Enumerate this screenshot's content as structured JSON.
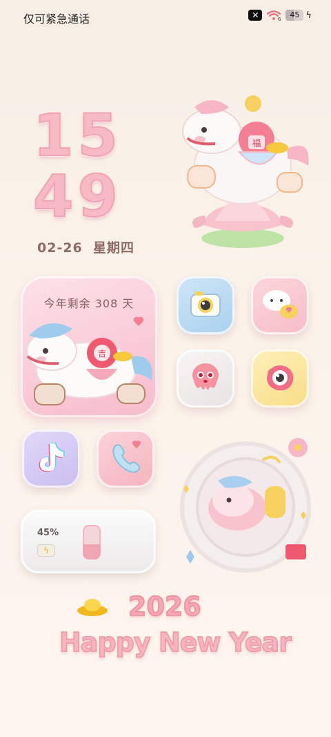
{
  "status_bar": {
    "carrier_text": "仅可紧急通话",
    "sim_icon": "sim-disabled-icon",
    "wifi_icon": "wifi-icon",
    "wifi_label": "6",
    "battery_level": "45",
    "charging_icon": "lightning-icon"
  },
  "clock": {
    "hours": "15",
    "minutes": "49",
    "date": "02-26",
    "weekday": "星期四"
  },
  "countdown_widget": {
    "text": "今年剩余 308 天"
  },
  "apps": [
    {
      "name": "camera",
      "icon": "camera-icon"
    },
    {
      "name": "messages",
      "icon": "chat-bubble-icon"
    },
    {
      "name": "octopus",
      "icon": "octopus-icon"
    },
    {
      "name": "eye",
      "icon": "eye-icon"
    },
    {
      "name": "tiktok",
      "icon": "tiktok-icon"
    },
    {
      "name": "phone",
      "icon": "phone-icon"
    }
  ],
  "battery_widget": {
    "percent_text": "45%",
    "level": 0.45
  },
  "new_year": {
    "year": "2026",
    "greeting": "Happy New Year"
  },
  "colors": {
    "clock_pink": "#f7b9c4",
    "date_brown": "#8f6b66",
    "accent_pink": "#f0a5b3"
  }
}
